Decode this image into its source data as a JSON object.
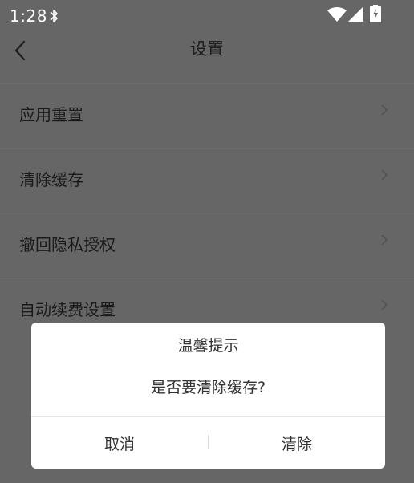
{
  "status_bar": {
    "time": "1:28",
    "icons": [
      "bluetooth-icon",
      "wifi-icon",
      "signal-icon",
      "battery-charging-icon"
    ]
  },
  "app_bar": {
    "back_icon": "chevron-left-icon",
    "title": "设置"
  },
  "settings": {
    "items": [
      {
        "label": "应用重置",
        "icon": "chevron-right-icon"
      },
      {
        "label": "清除缓存",
        "icon": "chevron-right-icon"
      },
      {
        "label": "撤回隐私授权",
        "icon": "chevron-right-icon"
      },
      {
        "label": "自动续费设置",
        "icon": "chevron-right-icon"
      }
    ]
  },
  "dialog": {
    "title": "温馨提示",
    "message": "是否要清除缓存?",
    "cancel_label": "取消",
    "confirm_label": "清除"
  },
  "colors": {
    "overlay_background": "#666666",
    "dialog_background": "#ffffff",
    "text_dark": "#333333",
    "status_text": "#ffffff"
  }
}
